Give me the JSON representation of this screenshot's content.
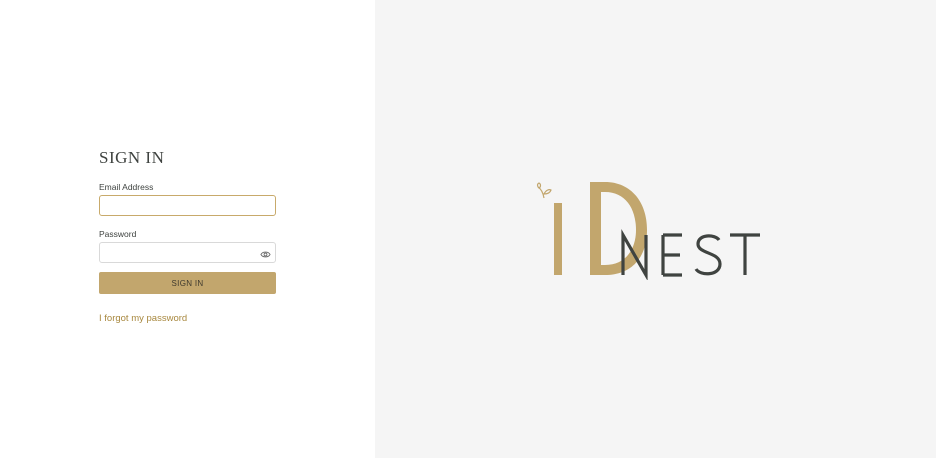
{
  "login": {
    "title": "SIGN IN",
    "email_label": "Email Address",
    "email_value": "",
    "email_placeholder": "",
    "password_label": "Password",
    "password_value": "",
    "password_placeholder": "",
    "show_password_icon": "eye-icon",
    "submit_label": "SIGN IN",
    "forgot_link": "I forgot my password"
  },
  "brand": {
    "logo_wordmark": "NEST",
    "logo_letters": "iD",
    "logo_icon": "leaf-icon"
  },
  "colors": {
    "accent_gold": "#c2a66d",
    "link_gold": "#a8883f",
    "text_dark": "#3f4340",
    "panel_gray": "#f5f5f5"
  }
}
